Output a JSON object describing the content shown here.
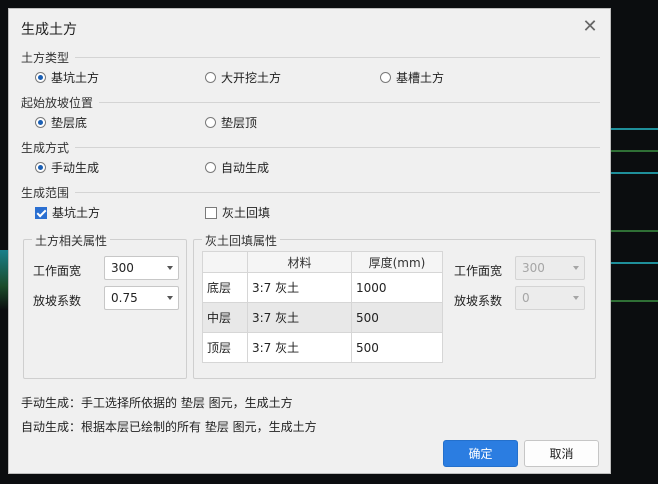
{
  "dialog": {
    "title": "生成土方"
  },
  "earthwork_type": {
    "label": "土方类型",
    "options": [
      {
        "label": "基坑土方",
        "selected": true
      },
      {
        "label": "大开挖土方",
        "selected": false
      },
      {
        "label": "基槽土方",
        "selected": false
      }
    ]
  },
  "start_position": {
    "label": "起始放坡位置",
    "options": [
      {
        "label": "垫层底",
        "selected": true
      },
      {
        "label": "垫层顶",
        "selected": false
      }
    ]
  },
  "generation_mode": {
    "label": "生成方式",
    "options": [
      {
        "label": "手动生成",
        "selected": true
      },
      {
        "label": "自动生成",
        "selected": false
      }
    ]
  },
  "generation_scope": {
    "label": "生成范围",
    "options": [
      {
        "label": "基坑土方",
        "checked": true
      },
      {
        "label": "灰土回填",
        "checked": false
      }
    ]
  },
  "earthwork_props": {
    "title": "土方相关属性",
    "work_width_label": "工作面宽",
    "work_width_value": "300",
    "slope_label": "放坡系数",
    "slope_value": "0.75"
  },
  "backfill_props": {
    "title": "灰土回填属性",
    "columns": [
      "",
      "材料",
      "厚度(mm)"
    ],
    "rows": [
      {
        "layer": "底层",
        "material": "3:7 灰土",
        "thickness": "1000"
      },
      {
        "layer": "中层",
        "material": "3:7 灰土",
        "thickness": "500"
      },
      {
        "layer": "顶层",
        "material": "3:7 灰土",
        "thickness": "500"
      }
    ],
    "work_width_label": "工作面宽",
    "work_width_value": "300",
    "slope_label": "放坡系数",
    "slope_value": "0"
  },
  "notes": [
    "手动生成：手工选择所依据的 垫层 图元，生成土方",
    "自动生成：根据本层已绘制的所有 垫层 图元，生成土方"
  ],
  "buttons": {
    "ok": "确定",
    "cancel": "取消"
  },
  "icons": {
    "close": "close-icon",
    "dropdown": "chevron-down-icon"
  },
  "colors": {
    "primary": "#2b7de1",
    "radio_selected": "#1a5fb4",
    "checkbox_checked": "#2a6fd1"
  }
}
